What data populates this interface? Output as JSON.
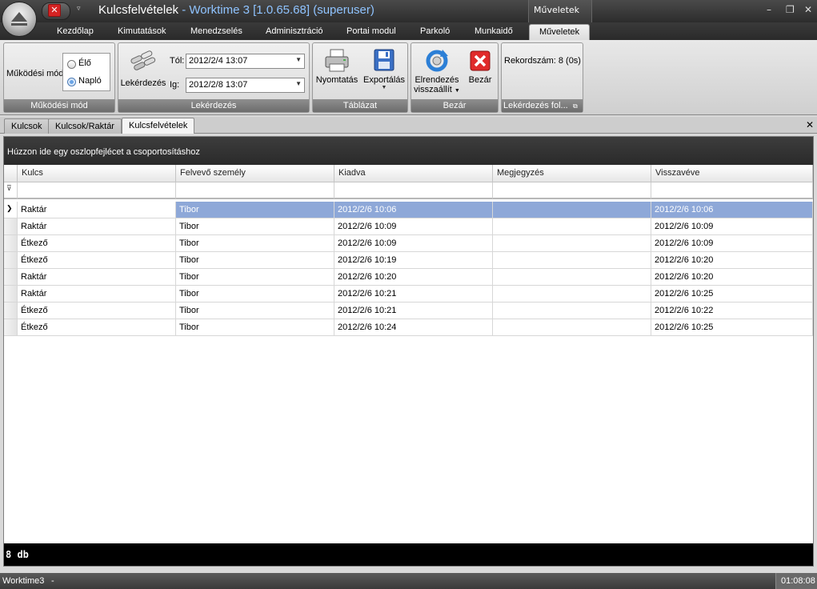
{
  "window": {
    "title_doc": "Kulcsfelvételek",
    "title_app": "- Worktime 3 [1.0.65.68] (superuser)",
    "context_tab_header": "Műveletek"
  },
  "tabs": [
    "Kezdőlap",
    "Kimutatások",
    "Menedzselés",
    "Adminisztráció",
    "Portai modul",
    "Parkoló",
    "Munkaidő",
    "Műveletek"
  ],
  "ribbon": {
    "mode_group": {
      "label": "Működési mód",
      "field_label": "Működési mód",
      "option_live": "Élő",
      "option_log": "Napló",
      "selected": "Napló"
    },
    "query_group": {
      "label": "Lekérdezés",
      "button_label": "Lekérdezés",
      "from_label": "Tól:",
      "from_value": "2012/2/4 13:07",
      "to_label": "Ig:",
      "to_value": "2012/2/8 13:07"
    },
    "table_group": {
      "label": "Táblázat",
      "print_label": "Nyomtatás",
      "export_label": "Exportálás"
    },
    "close_group": {
      "label": "Bezár",
      "reset_layout_label_1": "Elrendezés",
      "reset_layout_label_2": "visszaállít",
      "close_label": "Bezár"
    },
    "status_group": {
      "label": "Lekérdezés fol...",
      "record_count": "Rekordszám: 8 (0s)"
    }
  },
  "doc_tabs": [
    "Kulcsok",
    "Kulcsok/Raktár",
    "Kulcsfelvételek"
  ],
  "grid": {
    "group_hint": "Húzzon ide egy oszlopfejlécet a csoportosításhoz",
    "columns": [
      "Kulcs",
      "Felvevő személy",
      "Kiadva",
      "Megjegyzés",
      "Visszavéve"
    ],
    "rows": [
      [
        "Raktár",
        "Tibor",
        "2012/2/6 10:06",
        "",
        "2012/2/6 10:06"
      ],
      [
        "Raktár",
        "Tibor",
        "2012/2/6 10:09",
        "",
        "2012/2/6 10:09"
      ],
      [
        "Étkező",
        "Tibor",
        "2012/2/6 10:09",
        "",
        "2012/2/6 10:09"
      ],
      [
        "Étkező",
        "Tibor",
        "2012/2/6 10:19",
        "",
        "2012/2/6 10:20"
      ],
      [
        "Raktár",
        "Tibor",
        "2012/2/6 10:20",
        "",
        "2012/2/6 10:20"
      ],
      [
        "Raktár",
        "Tibor",
        "2012/2/6 10:21",
        "",
        "2012/2/6 10:25"
      ],
      [
        "Étkező",
        "Tibor",
        "2012/2/6 10:21",
        "",
        "2012/2/6 10:22"
      ],
      [
        "Étkező",
        "Tibor",
        "2012/2/6 10:24",
        "",
        "2012/2/6 10:25"
      ]
    ],
    "footer": "8 db"
  },
  "statusbar": {
    "left": "Worktime3",
    "dash": "-",
    "clock": "01:08:08"
  }
}
